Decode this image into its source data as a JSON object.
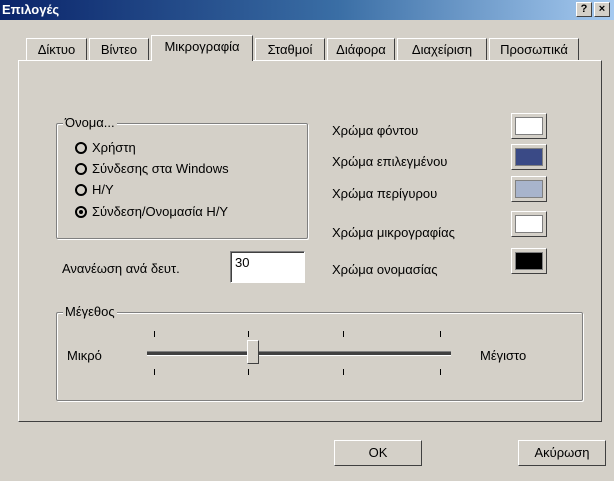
{
  "window": {
    "title": "Επιλογές",
    "help_label": "?",
    "close_label": "×"
  },
  "tabs": [
    {
      "label": "Δίκτυο"
    },
    {
      "label": "Βίντεο"
    },
    {
      "label": "Μικρογραφία",
      "active": true
    },
    {
      "label": "Σταθμοί"
    },
    {
      "label": "Διάφορα"
    },
    {
      "label": "Διαχείριση"
    },
    {
      "label": "Προσωπικά"
    }
  ],
  "name_group": {
    "legend": "Όνομα...",
    "options": [
      {
        "label": "Χρήστη",
        "checked": false
      },
      {
        "label": "Σύνδεσης στα Windows",
        "checked": false
      },
      {
        "label": "Η/Υ",
        "checked": false
      },
      {
        "label": "Σύνδεση/Ονομασία Η/Υ",
        "checked": true
      }
    ]
  },
  "refresh": {
    "label": "Ανανέωση ανά δευτ.",
    "value": "30"
  },
  "colors": [
    {
      "label": "Χρώμα φόντου",
      "color": "#ffffff"
    },
    {
      "label": "Χρώμα επιλεγμένου",
      "color": "#3a4a86"
    },
    {
      "label": "Χρώμα περίγυρου",
      "color": "#a8b4cc"
    },
    {
      "label": "Χρώμα μικρογραφίας",
      "color": "#ffffff"
    },
    {
      "label": "Χρώμα ονομασίας",
      "color": "#000000"
    }
  ],
  "size_group": {
    "legend": "Μέγεθος",
    "min_label": "Μικρό",
    "max_label": "Μέγιστο",
    "slider_position": 0.33,
    "tick_count": 4
  },
  "buttons": {
    "ok": "OK",
    "cancel": "Ακύρωση"
  }
}
